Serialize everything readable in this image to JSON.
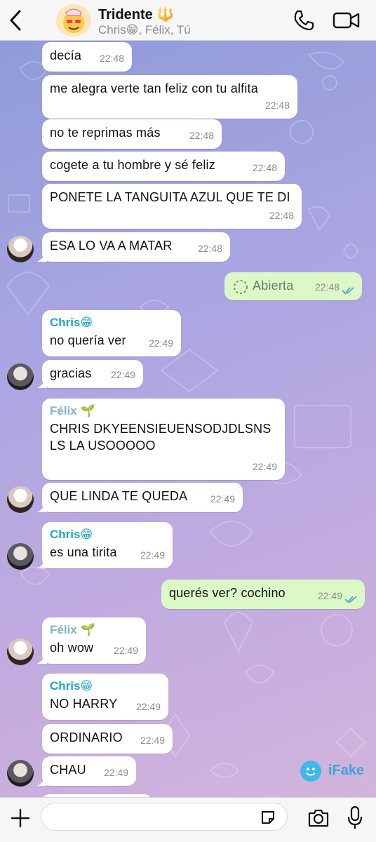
{
  "header": {
    "title": "Tridente 🔱",
    "subtitle": "Chris😁, Félix, Tú"
  },
  "messages": [
    {
      "text": "decía",
      "time": "22:48"
    },
    {
      "text": "me alegra verte tan feliz con tu alfita",
      "time": "22:48"
    },
    {
      "text": "no te reprimas más",
      "time": "22:48"
    },
    {
      "text": "cogete a tu hombre y sé feliz",
      "time": "22:48"
    },
    {
      "text": "PONETE LA TANGUITA AZUL QUE TE DI",
      "time": "22:48"
    },
    {
      "text": "ESA LO VA A MATAR",
      "time": "22:48"
    },
    {
      "text": "Abierta",
      "time": "22:48",
      "outgoing": true
    },
    {
      "sender": "Chris😁",
      "text": "no quería ver",
      "time": "22:49"
    },
    {
      "text": "gracias",
      "time": "22:49"
    },
    {
      "sender": "Félix 🌱",
      "text": "CHRIS DKYEENSIEUENSODJDLSNSLS LA USOOOOO",
      "time": "22:49"
    },
    {
      "text": "QUE LINDA TE QUEDA",
      "time": "22:49"
    },
    {
      "sender": "Chris😁",
      "text": "es una tirita",
      "time": "22:49"
    },
    {
      "text": "querés ver? cochino",
      "time": "22:49",
      "outgoing": true
    },
    {
      "sender": "Félix 🌱",
      "text": "oh wow",
      "time": "22:49"
    },
    {
      "sender": "Chris😁",
      "text": "NO HARRY",
      "time": "22:49"
    },
    {
      "text": "ORDINARIO",
      "time": "22:49"
    },
    {
      "text": "CHAU",
      "time": "22:49"
    }
  ],
  "watermark": {
    "label": "iFake"
  },
  "composer": {
    "placeholder": ""
  },
  "colors": {
    "outgoing_bubble": "#dcf8c6",
    "incoming_bubble": "#ffffff",
    "chris_name": "#1fa6c6",
    "felix_name": "#86b2c0",
    "read_ticks": "#4fa3e0"
  }
}
